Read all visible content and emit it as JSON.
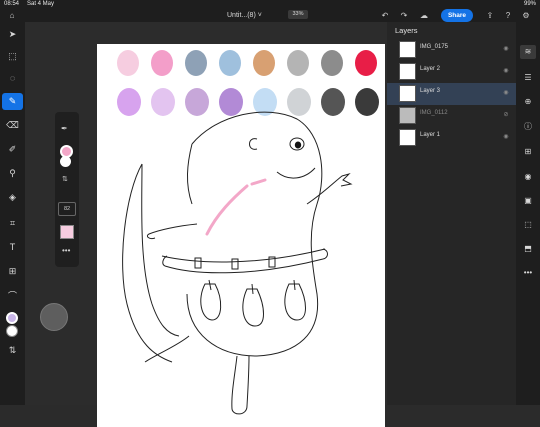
{
  "status": {
    "time": "08:54",
    "date": "Sat 4 May",
    "battery": "99%"
  },
  "header": {
    "doc_title": "Untit...(8)",
    "zoom": "33%",
    "share_label": "Share",
    "undo_icon": "undo-icon",
    "redo_icon": "redo-icon",
    "cloud_icon": "cloud-icon",
    "share_icon": "share-out-icon",
    "help_icon": "help-icon",
    "settings_icon": "gear-icon"
  },
  "swatches": [
    "#f6cde0",
    "#f39ec9",
    "#8ea1b6",
    "#9fc0dd",
    "#d8a072",
    "#b4b4b4",
    "#8c8c8c",
    "#e81e47",
    "#d7a3ee",
    "#e3c4f0",
    "#c7a7d9",
    "#b28ad6",
    "#c3ddf4",
    "#d0d3d6",
    "#555555",
    "#3a3a3a"
  ],
  "layers": {
    "title": "Layers",
    "items": [
      {
        "name": "IMG_0175",
        "dim": false,
        "selected": false
      },
      {
        "name": "Layer 2",
        "dim": false,
        "selected": false
      },
      {
        "name": "Layer 3",
        "dim": false,
        "selected": true
      },
      {
        "name": "IMG_0112",
        "dim": true,
        "selected": false
      },
      {
        "name": "Layer 1",
        "dim": false,
        "selected": false
      }
    ]
  },
  "brush_panel": {
    "size_value": "82"
  },
  "colors": {
    "accent": "#1473e6",
    "panel": "#262626",
    "toolbar": "#1e1e1e"
  }
}
